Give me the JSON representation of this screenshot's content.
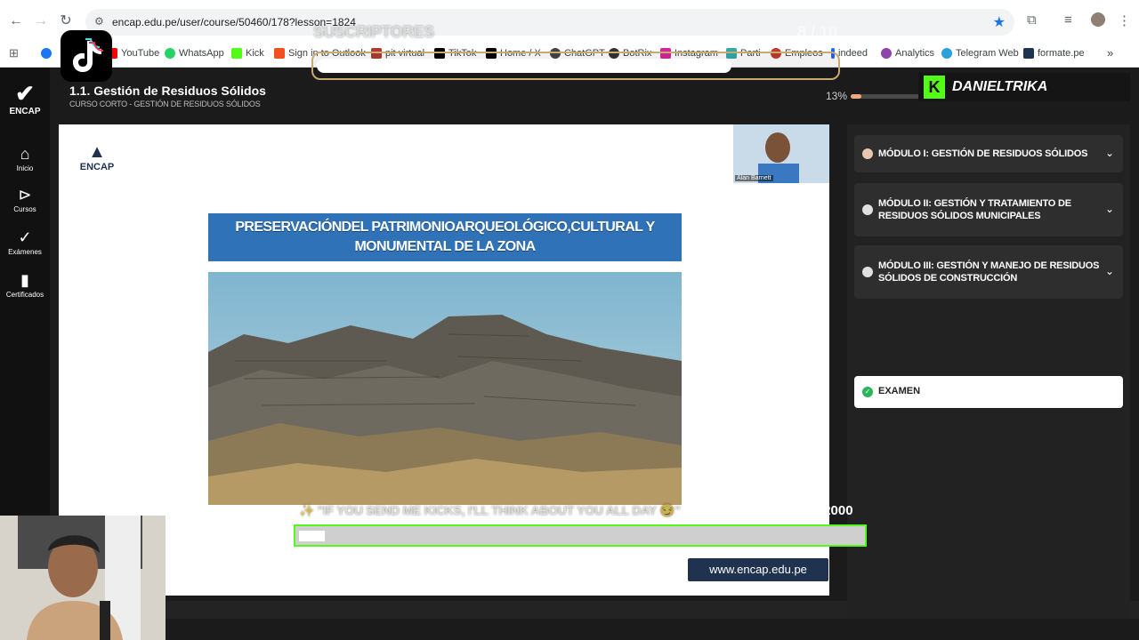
{
  "browser": {
    "url": "encap.edu.pe/user/course/50460/178?lesson=1824",
    "bookmarks": [
      "YouTube",
      "WhatsApp",
      "Kick",
      "Sign in to Outlook",
      "pit virtual",
      "TikTok",
      "Home / X",
      "ChatGPT",
      "BotRix",
      "Instagram",
      "Parti",
      "Empleos",
      "indeed",
      "Analytics",
      "Telegram Web",
      "formate.pe"
    ],
    "more_label": "»"
  },
  "rail": {
    "logo_text": "ENCAP",
    "items": [
      {
        "label": "Inicio",
        "icon": "home-icon"
      },
      {
        "label": "Cursos",
        "icon": "play-circle-icon"
      },
      {
        "label": "Exámenes",
        "icon": "check-icon"
      },
      {
        "label": "Certificados",
        "icon": "bookmark-icon"
      }
    ]
  },
  "header": {
    "lesson_title": "1.1. Gestión de Residuos Sólidos",
    "course_subtitle": "CURSO CORTO - GESTIÓN DE RESIDUOS SÓLIDOS",
    "progress_label": "13%",
    "progress_value": 0.13
  },
  "slide": {
    "logo_text": "ENCAP",
    "banner_line1": "PRESERVACIÓNDEL PATRIMONIOARQUEOLÓGICO,CULTURAL Y",
    "banner_line2": "MONUMENTAL DE LA  ZONA",
    "website": "www.encap.edu.pe",
    "presenter_name": "Alan Barnett"
  },
  "modules": [
    {
      "label": "MÓDULO I: GESTIÓN DE RESIDUOS SÓLIDOS",
      "status": "done"
    },
    {
      "label": "MÓDULO II: GESTIÓN Y TRATAMIENTO DE RESIDUOS SÓLIDOS MUNICIPALES",
      "status": "pending"
    },
    {
      "label": "MÓDULO III: GESTIÓN Y MANEJO DE RESIDUOS SÓLIDOS DE CONSTRUCCIÓN",
      "status": "pending"
    }
  ],
  "exam": {
    "label": "EXAMEN"
  },
  "overlay": {
    "subs_label": "SUSCRIPTORES",
    "subs_current": "8",
    "subs_goal": "/ 10",
    "subs_progress": 0.8,
    "kick_name": "DANIELTRIKA",
    "kicks_text": "✨ \"IF YOU SEND ME KICKS, I'LL THINK ABOUT YOU ALL DAY 😏\"",
    "kicks_current": "91",
    "kicks_goal": "/ 2000",
    "kicks_progress": 0.0455
  },
  "colors": {
    "accent_green": "#53fc18",
    "progress_orange": "#f0a97a",
    "brand_navy": "#1f3350",
    "banner_blue": "#2f72b8"
  }
}
